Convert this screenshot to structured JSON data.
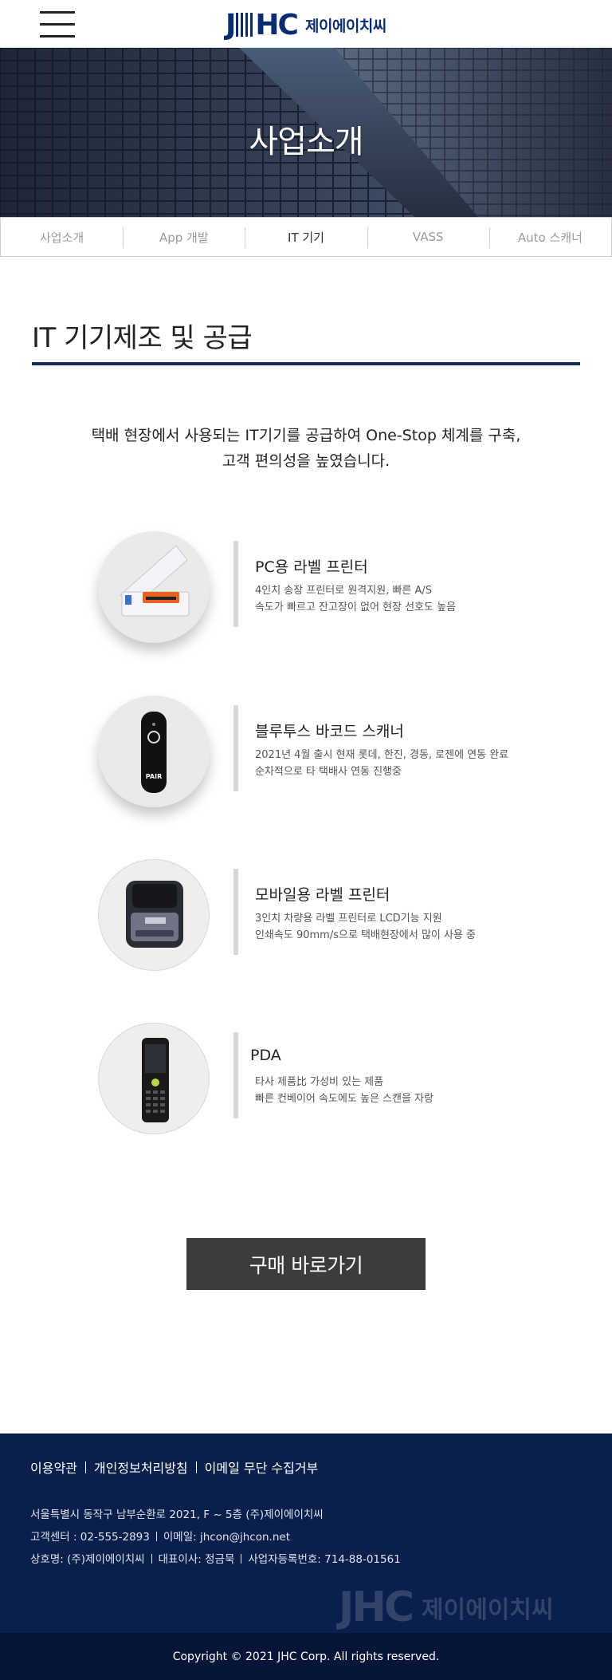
{
  "header": {
    "logo_mark_j": "J",
    "logo_mark_h": "H",
    "logo_mark_c": "C",
    "logo_text": "제이에이치씨",
    "menu_icon": "hamburger-menu-icon"
  },
  "hero": {
    "title": "사업소개"
  },
  "tabs": [
    {
      "label": "사업소개",
      "active": false
    },
    {
      "label": "App 개발",
      "active": false
    },
    {
      "label": "IT 기기",
      "active": true
    },
    {
      "label": "VASS",
      "active": false
    },
    {
      "label": "Auto 스캐너",
      "active": false
    }
  ],
  "section": {
    "title": "IT 기기제조 및 공급",
    "intro_line1": "택배 현장에서 사용되는 IT기기를 공급하여 One-Stop 체계를 구축,",
    "intro_line2": "고객 편의성을 높였습니다."
  },
  "products": [
    {
      "name": "PC용 라벨 프린터",
      "desc1": "4인치 송장 프린터로 원격지원, 빠른 A/S",
      "desc2": "속도가 빠르고 잔고장이 없어 현장 선호도 높음",
      "icon": "label-printer-icon"
    },
    {
      "name": "블루투스 바코드 스캐너",
      "desc1": "2021년 4월 출시 현재 롯데, 한진, 경동, 로젠에 연동 완료",
      "desc2": "순차적으로 타 택배사 연동 진행중",
      "icon": "barcode-scanner-icon",
      "device_label": "PAIR"
    },
    {
      "name": "모바일용 라벨 프린터",
      "desc1": "3인치 차량용 라벨 프린터로 LCD기능 지원",
      "desc2": "인쇄속도 90mm/s으로 택배현장에서 많이 사용 중",
      "icon": "mobile-printer-icon"
    },
    {
      "name": "PDA",
      "desc1": "타사 제품比 가성비 있는 제품",
      "desc2": "빠른 컨베이어 속도에도 높은 스캔을 자랑",
      "icon": "pda-icon"
    }
  ],
  "buy_button": {
    "label": "구매 바로가기"
  },
  "footer": {
    "links": [
      "이용약관",
      "개인정보처리방침",
      "이메일 무단 수집거부"
    ],
    "address": "서울특별시 동작구 남부순환로 2021, F ~ 5층 (주)제이에이치씨",
    "phone": "고객센터 : 02-555-2893",
    "email": "이메일: jhcon@jhcon.net",
    "company": "상호명: (주)제이에이치씨",
    "ceo": "대표이사: 정금묵",
    "biz_no": "사업자등록번호: 714-88-01561",
    "logo_mark": "JHC",
    "logo_text": "제이에이치씨",
    "copyright": "Copyright © 2021 JHC Corp. All rights reserved."
  },
  "colors": {
    "brand_navy": "#0a2c6e",
    "footer_bg": "#0b1f4d",
    "copyright_bg": "#071638",
    "button_bg": "#3c3c3c",
    "rule": "#102a5c"
  }
}
